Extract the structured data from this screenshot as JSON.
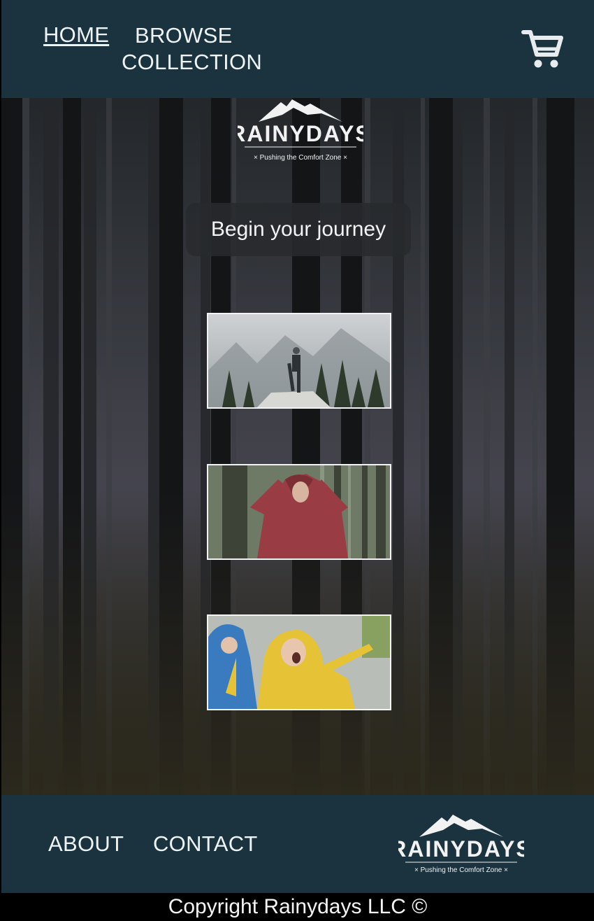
{
  "nav": {
    "home_label": "HOME",
    "browse_line1": "BROWSE",
    "browse_line2": "COLLECTION",
    "cart_icon": "shopping-cart-icon"
  },
  "brand": {
    "name": "RAINYDAYS",
    "tagline": "× Pushing the Comfort Zone ×"
  },
  "hero": {
    "heading": "Begin your journey",
    "photos": [
      {
        "subject": "hiker on rock overlooking misty forest"
      },
      {
        "subject": "person in red rain jacket in forest"
      },
      {
        "subject": "child in yellow raincoat in the rain"
      }
    ]
  },
  "footer": {
    "about_label": "ABOUT",
    "contact_label": "CONTACT",
    "copyright": "Copyright Rainydays LLC ©"
  },
  "colors": {
    "header_bg": "#1b333f",
    "text": "#eef3f5"
  }
}
